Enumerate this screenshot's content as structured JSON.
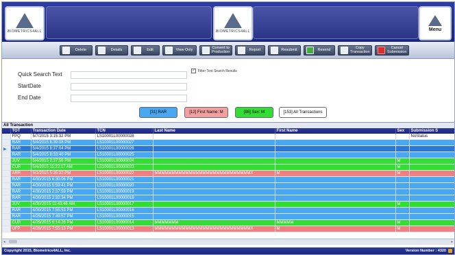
{
  "header": {
    "logo_text": "BIOMETRICS4ALL",
    "menu_label": "Menu"
  },
  "toolbar": {
    "buttons": [
      {
        "label": "Delete",
        "icon": "document-icon"
      },
      {
        "label": "Details",
        "icon": "document-icon"
      },
      {
        "label": "Edit",
        "icon": "edit-icon"
      },
      {
        "label": "View Only",
        "icon": "search-icon"
      },
      {
        "label": "Convert to Production",
        "icon": "convert-icon"
      },
      {
        "label": "Report",
        "icon": "report-icon"
      },
      {
        "label": "Resubmit",
        "icon": "refresh-icon"
      },
      {
        "label": "Resend",
        "icon": "resend-icon"
      },
      {
        "label": "Copy Transaction",
        "icon": "copy-icon"
      },
      {
        "label": "Cancel Submission",
        "icon": "cancel-icon"
      }
    ]
  },
  "search": {
    "quick_label": "Quick Search Text",
    "start_label": "StartDate",
    "end_label": "End Date",
    "quick_value": "",
    "start_value": "",
    "end_value": "",
    "filter_label": "Filter Text Search Results",
    "filter_checked": true
  },
  "filters": [
    {
      "label": "[31] RAR",
      "color": "#4aa8f0"
    },
    {
      "label": "[12] First Name: M",
      "color": "#f4a0a0"
    },
    {
      "label": "[86] Sex: M",
      "color": "#33dd33"
    },
    {
      "label": "[153] All Transactions",
      "color": "#ffffff"
    }
  ],
  "grid": {
    "title": "All Transaction",
    "columns": [
      "TOT",
      "Transaction Date",
      "TCN",
      "Last Name",
      "First Name",
      "Sex",
      "Submission S"
    ],
    "rows": [
      {
        "tot": "FPQ",
        "date": "5/7/2015 3:15:32 PM",
        "tcn": "LS10001L00000028",
        "last": "",
        "first": "",
        "sex": "",
        "status": "NoStatus",
        "bg": "#ffffff",
        "fg": "#111111"
      },
      {
        "tot": "RAR",
        "date": "5/4/2015 8:39:08 PM",
        "tcn": "LS10001L00000027",
        "last": "",
        "first": "",
        "sex": "",
        "status": "",
        "bg": "#4aa8f0",
        "fg": "#ffffff"
      },
      {
        "tot": "RAR",
        "date": "5/4/2015 8:37:04 PM",
        "tcn": "LS10001L00000026",
        "last": "",
        "first": "",
        "sex": "",
        "status": "",
        "bg": "#2a78d8",
        "fg": "#ffffff"
      },
      {
        "tot": "RAR",
        "date": "5/4/2015 8:33:40 PM",
        "tcn": "LS10001L00000025",
        "last": "",
        "first": "",
        "sex": "",
        "status": "",
        "bg": "#4aa8f0",
        "fg": "#ffffff"
      },
      {
        "tot": "JUV",
        "date": "5/4/2015 2:37:56 PM",
        "tcn": "LS10001L00000024",
        "last": "",
        "first": "",
        "sex": "M",
        "status": "",
        "bg": "#33dd33",
        "fg": "#ffffff"
      },
      {
        "tot": "CUR",
        "date": "5/4/2015 11:22:17 AM",
        "tcn": "LS10001L00000023",
        "last": "",
        "first": "",
        "sex": "M",
        "status": "",
        "bg": "#33dd33",
        "fg": "#ffffff"
      },
      {
        "tot": "ARR",
        "date": "5/1/2015 5:25:32 PM",
        "tcn": "LS10001L00000022",
        "last": "MMMMMMMMMMMMMMMMMMMMMMMMMMMMX",
        "first": "M",
        "sex": "M",
        "status": "",
        "bg": "#f08080",
        "fg": "#ffffff"
      },
      {
        "tot": "RAR",
        "date": "4/30/2015 6:30:06 PM",
        "tcn": "LS10001L00000021",
        "last": "",
        "first": "",
        "sex": "",
        "status": "",
        "bg": "#4aa8f0",
        "fg": "#ffffff"
      },
      {
        "tot": "RAR",
        "date": "4/30/2015 5:59:41 PM",
        "tcn": "LS10001L00000020",
        "last": "",
        "first": "",
        "sex": "",
        "status": "",
        "bg": "#4aa8f0",
        "fg": "#ffffff"
      },
      {
        "tot": "RAR",
        "date": "4/30/2015 2:37:59 PM",
        "tcn": "LS10001L00000019",
        "last": "",
        "first": "",
        "sex": "",
        "status": "",
        "bg": "#4aa8f0",
        "fg": "#ffffff"
      },
      {
        "tot": "RAR",
        "date": "4/30/2015 2:32:34 PM",
        "tcn": "LS10001L00000018",
        "last": "",
        "first": "",
        "sex": "",
        "status": "",
        "bg": "#4aa8f0",
        "fg": "#ffffff"
      },
      {
        "tot": "JUV",
        "date": "4/30/2015 11:43:46 AM",
        "tcn": "LS10001L00000017",
        "last": "",
        "first": "",
        "sex": "M",
        "status": "",
        "bg": "#33dd33",
        "fg": "#ffffff"
      },
      {
        "tot": "RAR",
        "date": "4/30/2015 7:55:53 PM",
        "tcn": "LS10001L00000016",
        "last": "",
        "first": "",
        "sex": "",
        "status": "",
        "bg": "#4aa8f0",
        "fg": "#ffffff"
      },
      {
        "tot": "RAR",
        "date": "4/29/2015 7:49:57 PM",
        "tcn": "LS10001L00000015",
        "last": "",
        "first": "",
        "sex": "",
        "status": "",
        "bg": "#4aa8f0",
        "fg": "#ffffff"
      },
      {
        "tot": "CUR",
        "date": "4/29/2015 6:14:26 PM",
        "tcn": "LS10001L00000014",
        "last": "MMMMMMM",
        "first": "MMMMM",
        "sex": "M",
        "status": "",
        "bg": "#33dd33",
        "fg": "#ffffff"
      },
      {
        "tot": "UFP",
        "date": "4/28/2015 7:55:13 PM",
        "tcn": "LS10001L00000013",
        "last": "MMMMMMMMMMMMMMMMMMMMMMMMMMMMX",
        "first": "M",
        "sex": "M",
        "status": "",
        "bg": "#f08080",
        "fg": "#ffffff"
      }
    ]
  },
  "footer": {
    "copyright": "Copyright 2015, Biometrics4ALL, Inc.",
    "version": "Version Number : 4320"
  }
}
